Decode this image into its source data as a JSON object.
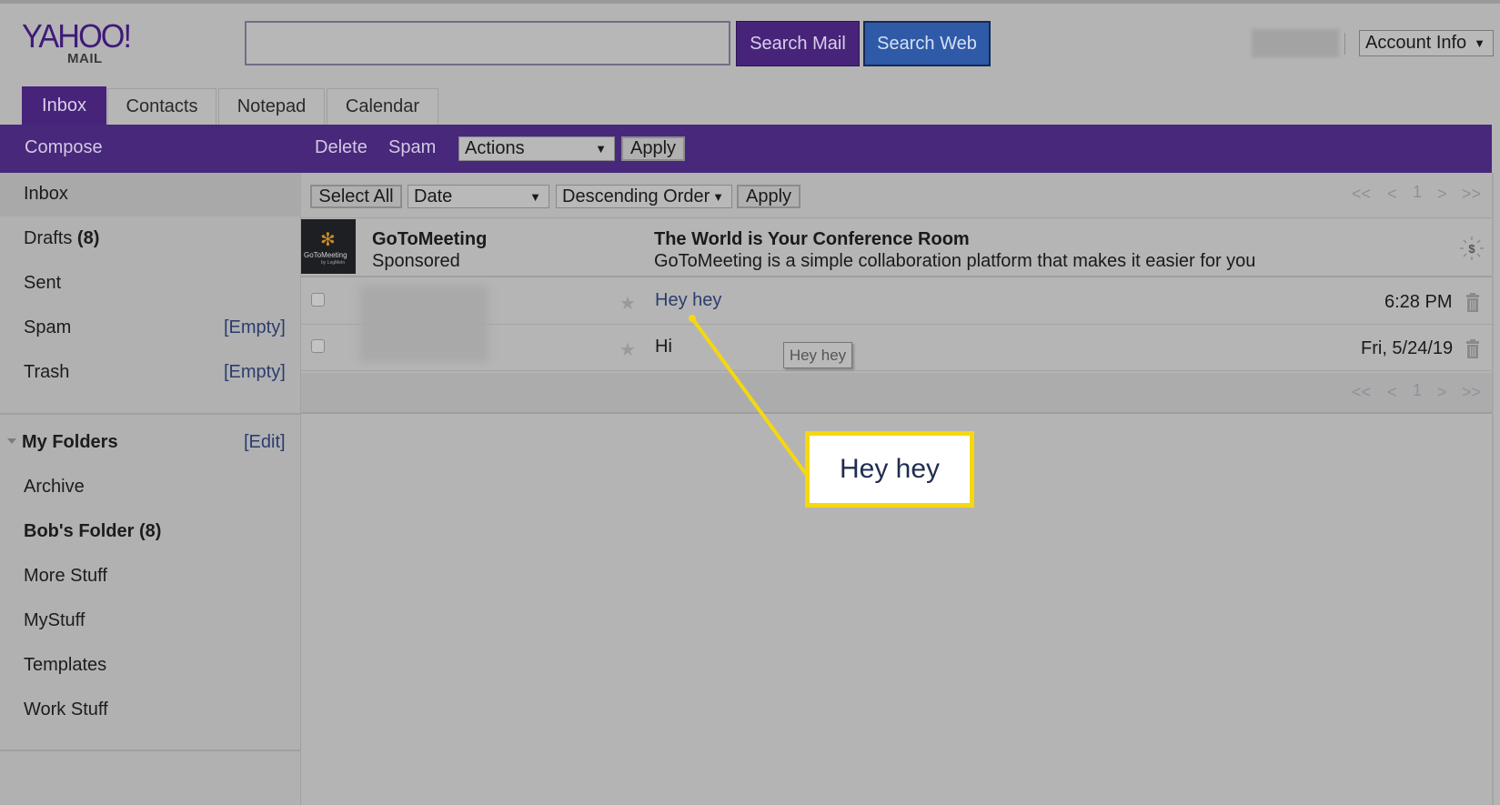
{
  "header": {
    "logo_text": "YAHOO!",
    "logo_sub": "MAIL",
    "search_placeholder": "",
    "search_mail_label": "Search Mail",
    "search_web_label": "Search Web",
    "account_label": "Account Info",
    "dropdown_arrow": "▼"
  },
  "tabs": [
    {
      "label": "Inbox",
      "active": true
    },
    {
      "label": "Contacts",
      "active": false
    },
    {
      "label": "Notepad",
      "active": false
    },
    {
      "label": "Calendar",
      "active": false
    }
  ],
  "action_bar": {
    "compose_label": "Compose",
    "delete_label": "Delete",
    "spam_label": "Spam",
    "actions_selected": "Actions",
    "apply_label": "Apply"
  },
  "sidebar": {
    "folders": [
      {
        "label": "Inbox",
        "count": "",
        "action": ""
      },
      {
        "label": "Drafts",
        "count": "(8)",
        "action": ""
      },
      {
        "label": "Sent",
        "count": "",
        "action": ""
      },
      {
        "label": "Spam",
        "count": "",
        "action": "[Empty]"
      },
      {
        "label": "Trash",
        "count": "",
        "action": "[Empty]"
      }
    ],
    "my_folders": {
      "title": "My Folders",
      "edit_label": "[Edit]",
      "items": [
        {
          "label": "Archive",
          "bold": false
        },
        {
          "label": "Bob's Folder (8)",
          "bold": true
        },
        {
          "label": "More Stuff",
          "bold": false
        },
        {
          "label": "MyStuff",
          "bold": false
        },
        {
          "label": "Templates",
          "bold": false
        },
        {
          "label": "Work Stuff",
          "bold": false
        }
      ]
    }
  },
  "list_toolbar": {
    "select_all_label": "Select All",
    "sort_field": "Date",
    "sort_order": "Descending Order",
    "apply_label": "Apply"
  },
  "pager": {
    "first": "<<",
    "prev": "<",
    "current": "1",
    "next": ">",
    "last": ">>"
  },
  "ad": {
    "sender": "GoToMeeting",
    "tag": "Sponsored",
    "subject": "The World is Your Conference Room",
    "preview": "GoToMeeting is a simple collaboration platform that makes it easier for you",
    "logo_text": "GoToMeeting",
    "logo_sub": "by LogMeIn",
    "icon": "dollar-badge-icon"
  },
  "messages": [
    {
      "subject": "Hey hey",
      "date": "6:28 PM",
      "starred": false,
      "checked": false,
      "link_style": true
    },
    {
      "subject": "Hi",
      "date": "Fri, 5/24/19",
      "starred": false,
      "checked": false,
      "link_style": false
    }
  ],
  "tooltip": {
    "text": "Hey hey"
  },
  "callout": {
    "text": "Hey hey",
    "color": "#f5d80f"
  },
  "colors": {
    "brand_purple": "#47287a",
    "search_web_blue": "#2e5aa8",
    "link_blue": "#2b3d6e",
    "highlight_yellow": "#f5d80f"
  }
}
